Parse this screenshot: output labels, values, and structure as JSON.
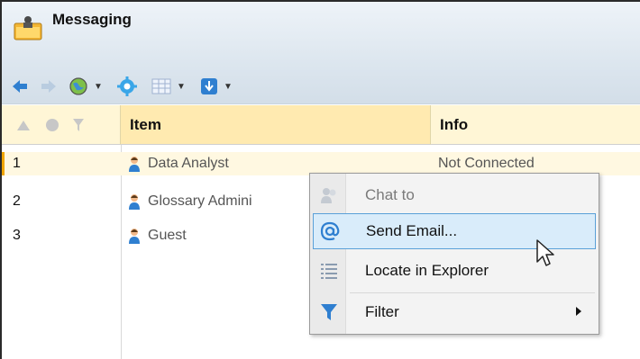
{
  "app": {
    "title": "Messaging",
    "icon": "messaging-icon"
  },
  "toolbar": {
    "buttons": [
      {
        "icon": "back-arrow-icon"
      },
      {
        "icon": "forward-arrow-icon"
      },
      {
        "icon": "globe-icon",
        "has_dropdown": true
      },
      {
        "icon": "gear-icon"
      },
      {
        "icon": "columns-icon",
        "has_dropdown": true
      },
      {
        "icon": "download-icon",
        "has_dropdown": true
      }
    ]
  },
  "table": {
    "columns": [
      "",
      "Item",
      "Info"
    ],
    "header_icons": [
      "sort-triangle-icon",
      "status-circle-icon",
      "filter-icon"
    ],
    "rows": [
      {
        "num": "1",
        "item": "Data Analyst",
        "info": "Not Connected"
      },
      {
        "num": "2",
        "item": "Glossary Admini",
        "info": ""
      },
      {
        "num": "3",
        "item": "Guest",
        "info": ""
      }
    ]
  },
  "context_menu": {
    "items": [
      {
        "label": "Chat to",
        "icon": "chat-icon",
        "disabled": true
      },
      {
        "label": "Send Email...",
        "icon": "at-sign-icon",
        "hovered": true
      },
      {
        "label": "Locate in Explorer",
        "icon": "list-icon"
      },
      {
        "label": "Filter",
        "icon": "filter-icon",
        "submenu": true
      }
    ]
  },
  "colors": {
    "accent_blue": "#2f7fd0",
    "selection": "#d9ecfa",
    "header_yellow": "#ffeab0"
  }
}
